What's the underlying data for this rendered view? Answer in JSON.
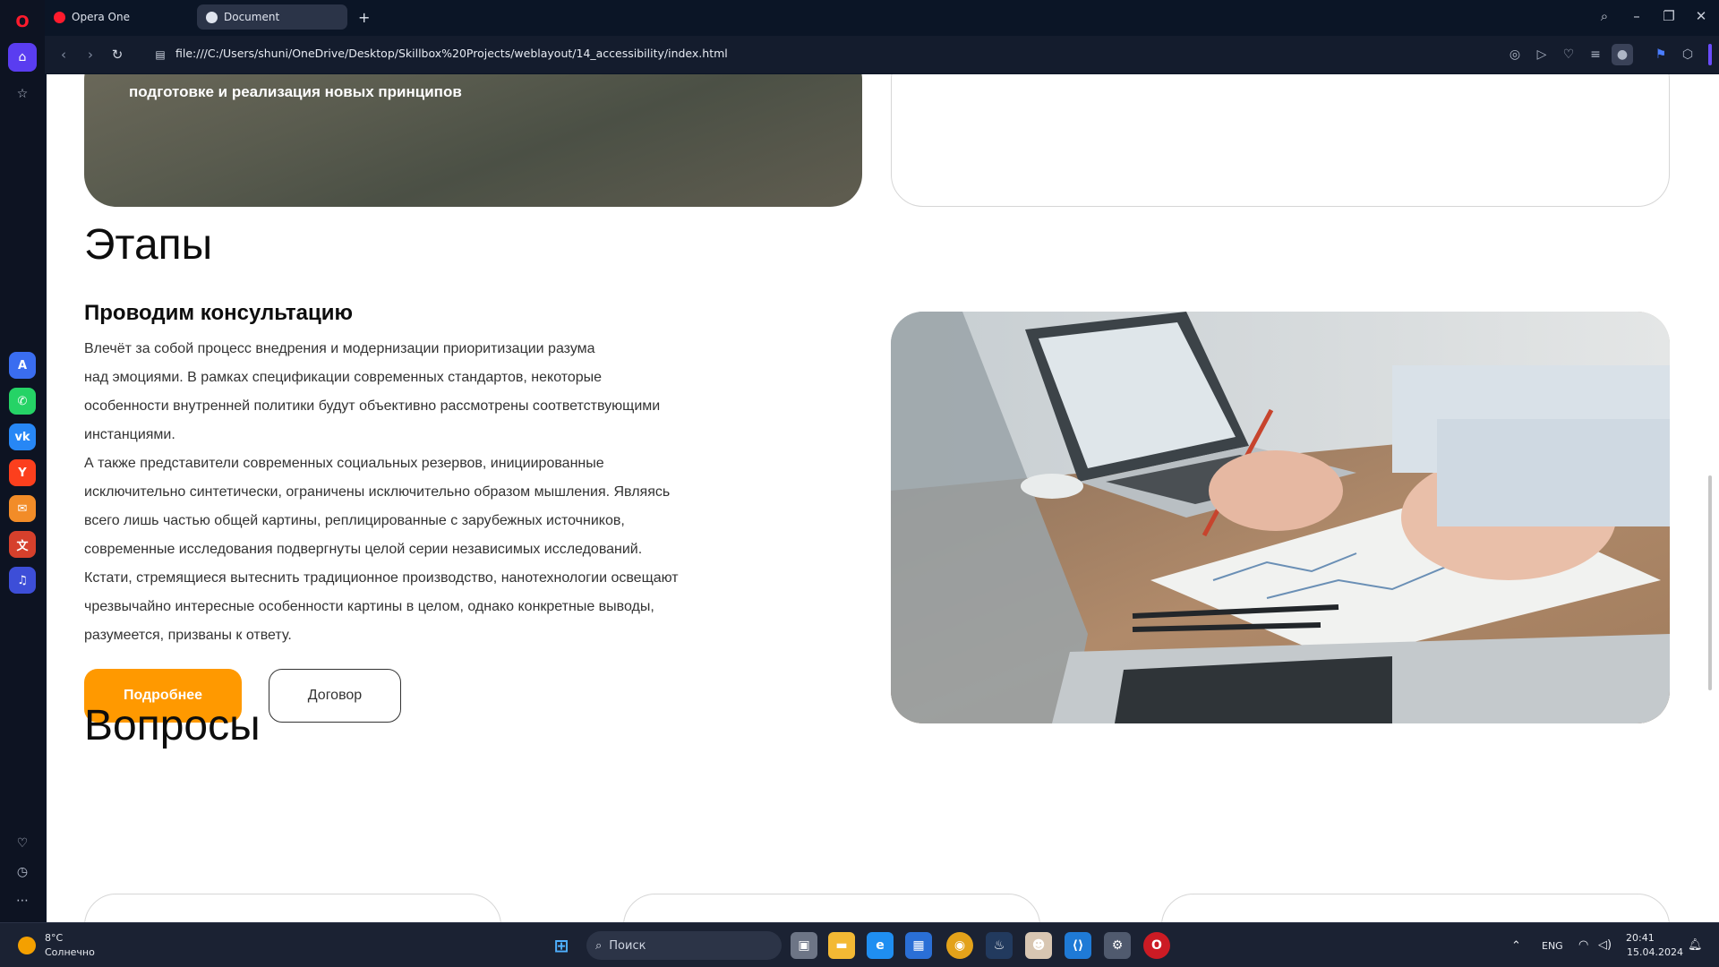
{
  "browser": {
    "tabs": [
      {
        "label": "Opera One"
      },
      {
        "label": "Document"
      }
    ],
    "new_tab": "+",
    "url": "file:///C:/Users/shuni/OneDrive/Desktop/Skillbox%20Projects/weblayout/14_accessibility/index.html"
  },
  "page": {
    "top_image_caption": "подготовке и реализация новых принципов",
    "stages": {
      "title": "Этапы",
      "subtitle": "Проводим консультацию",
      "paragraph_lines": [
        "Влечёт за собой процесс внедрения и модернизации приоритизации разума",
        "над эмоциями. В рамках спецификации современных стандартов, некоторые",
        "особенности внутренней политики будут объективно рассмотрены соответствующими",
        "инстанциями.",
        "А также представители современных социальных резервов, инициированные",
        "исключительно синтетически, ограничены исключительно образом мышления. Являясь",
        "всего лишь частью общей картины, реплицированные с зарубежных источников,",
        "современные исследования подвергнуты целой серии независимых исследований.",
        "Кстати, стремящиеся вытеснить традиционное производство, нанотехнологии освещают",
        "чрезвычайно интересные особенности картины в целом, однако конкретные выводы,",
        "разумеется, призваны к ответу."
      ],
      "primary_button": "Подробнее",
      "secondary_button": "Договор"
    },
    "questions": {
      "title": "Вопросы"
    }
  },
  "taskbar": {
    "weather_temp": "8°C",
    "weather_desc": "Солнечно",
    "search_placeholder": "Поиск",
    "language": "ENG",
    "time": "20:41",
    "date": "15.04.2024"
  },
  "colors": {
    "accent": "#ff9900",
    "browser_bg": "#0b1526"
  }
}
